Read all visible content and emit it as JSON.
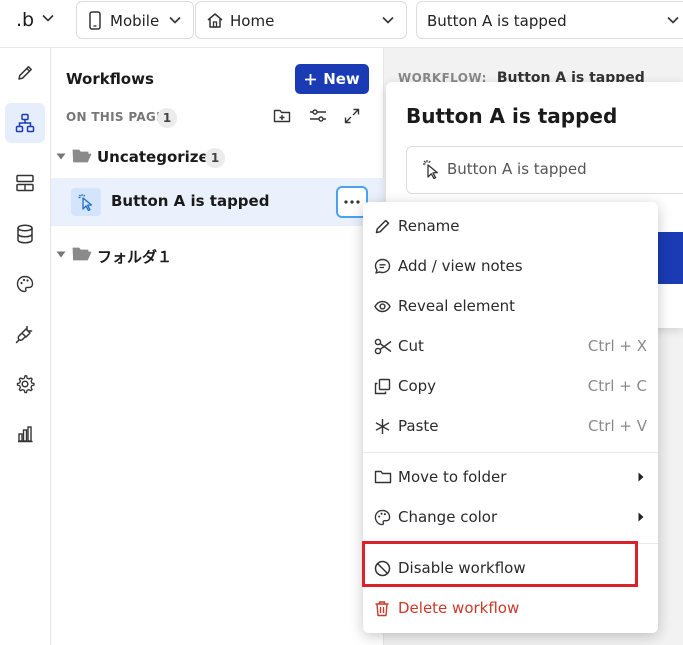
{
  "topbar": {
    "logo": ".b",
    "device": {
      "icon": "mobile-icon",
      "label": "Mobile"
    },
    "page": {
      "icon": "home-icon",
      "label": "Home"
    },
    "workflow_select": {
      "label": "Button A is tapped"
    }
  },
  "rail": {
    "items": [
      {
        "name": "design-tab",
        "icon": "pencil-icon"
      },
      {
        "name": "workflows-tab",
        "icon": "workflow-icon",
        "active": true
      },
      {
        "name": "data-tab",
        "icon": "layout-icon"
      },
      {
        "name": "database-tab",
        "icon": "database-icon"
      },
      {
        "name": "styles-tab",
        "icon": "palette-icon"
      },
      {
        "name": "plugins-tab",
        "icon": "plug-icon"
      },
      {
        "name": "settings-tab",
        "icon": "gear-icon"
      },
      {
        "name": "logs-tab",
        "icon": "bar-chart-icon"
      }
    ]
  },
  "workflows": {
    "title": "Workflows",
    "new_label": "New",
    "on_this_page": "ON THIS PAGE",
    "on_this_page_count": "1",
    "folders": [
      {
        "label": "Uncategorized",
        "count": "1",
        "items": [
          {
            "label": "Button A is tapped",
            "selected": true
          }
        ]
      },
      {
        "label": "フォルダ１",
        "count": "",
        "items": []
      }
    ]
  },
  "editor": {
    "header_key": "WORKFLOW:",
    "header_value": "Button A is tapped",
    "card_title": "Button A is tapped",
    "card_trigger": "Button A is tapped"
  },
  "context_menu": {
    "items": [
      {
        "label": "Rename",
        "icon": "pencil-icon",
        "shortcut": ""
      },
      {
        "label": "Add / view notes",
        "icon": "note-icon",
        "shortcut": ""
      },
      {
        "label": "Reveal element",
        "icon": "eye-icon",
        "shortcut": ""
      },
      {
        "label": "Cut",
        "icon": "scissors-icon",
        "shortcut": "Ctrl + X"
      },
      {
        "label": "Copy",
        "icon": "copy-icon",
        "shortcut": "Ctrl + C"
      },
      {
        "label": "Paste",
        "icon": "asterisk-icon",
        "shortcut": "Ctrl + V"
      },
      {
        "label": "Move to folder",
        "icon": "folder-icon",
        "submenu": true
      },
      {
        "label": "Change color",
        "icon": "palette-icon",
        "submenu": true
      },
      {
        "label": "Disable workflow",
        "icon": "disable-icon",
        "highlighted": true
      },
      {
        "label": "Delete workflow",
        "icon": "trash-icon",
        "danger": true
      }
    ]
  },
  "colors": {
    "accent": "#1a3bb3",
    "selected_row": "#eaf1fd",
    "danger": "#c93a2b",
    "highlight_box": "#d9232a"
  }
}
